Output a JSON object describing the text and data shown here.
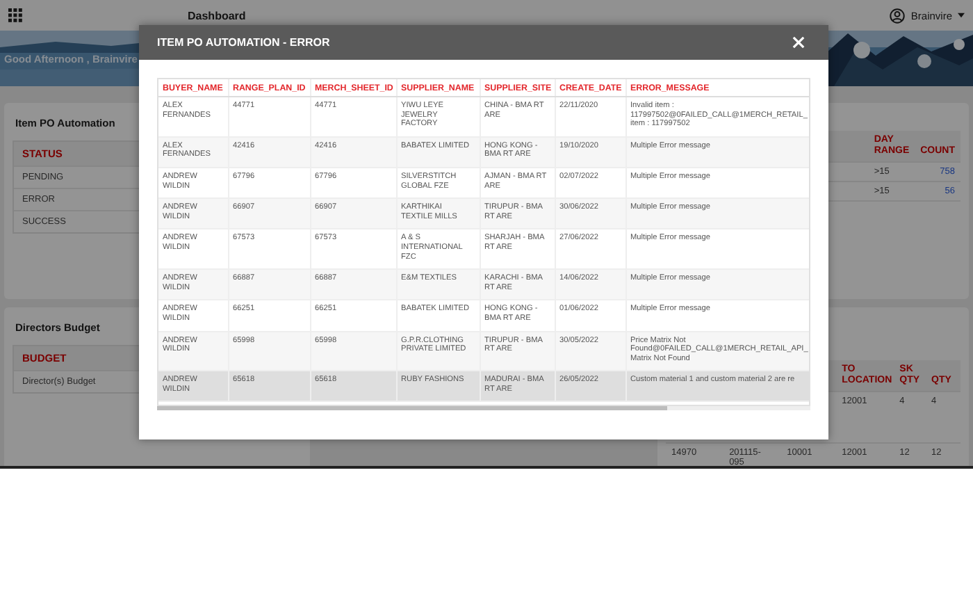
{
  "header": {
    "title": "Dashboard",
    "user": "Brainvire"
  },
  "banner": {
    "greeting": "Good Afternoon , Brainvire"
  },
  "status_panel": {
    "title": "Item PO Automation",
    "column": "STATUS",
    "rows": [
      "PENDING",
      "ERROR",
      "SUCCESS"
    ]
  },
  "budget_panel": {
    "title": "Directors Budget",
    "column": "BUDGET",
    "rows": [
      "Director(s) Budget"
    ]
  },
  "range_panel": {
    "columns": [
      "DAY RANGE",
      "COUNT"
    ],
    "rows": [
      {
        "cells": [
          ">15",
          "758"
        ]
      },
      {
        "cells": [
          ">15",
          "56"
        ]
      }
    ]
  },
  "transfer_panel": {
    "columns": [
      "TO LOCATION",
      "SK QTY",
      "QTY"
    ],
    "rows": [
      {
        "cells": [
          "12001",
          "4",
          "4"
        ]
      },
      {
        "cells": [
          "14970",
          "201115-095",
          "10001",
          "12001",
          "12",
          "12"
        ]
      }
    ]
  },
  "modal": {
    "title": "ITEM PO AUTOMATION - ERROR",
    "columns": [
      "BUYER_NAME",
      "RANGE_PLAN_ID",
      "MERCH_SHEET_ID",
      "SUPPLIER_NAME",
      "SUPPLIER_SITE",
      "CREATE_DATE",
      "ERROR_MESSAGE"
    ],
    "rows": [
      {
        "cells": [
          "ALEX FERNANDES",
          "44771",
          "44771",
          "YIWU LEYE JEWELRY FACTORY",
          "CHINA - BMA RT ARE",
          "22/11/2020",
          "Invalid item : 117997502@0FAILED_CALL@1MERCH_RETAIL_ item : 117997502"
        ],
        "selected": false
      },
      {
        "cells": [
          "ALEX FERNANDES",
          "42416",
          "42416",
          "BABATEX LIMITED",
          "HONG KONG - BMA RT ARE",
          "19/10/2020",
          "Multiple Error message"
        ],
        "selected": false
      },
      {
        "cells": [
          "ANDREW WILDIN",
          "67796",
          "67796",
          "SILVERSTITCH GLOBAL FZE",
          "AJMAN - BMA RT ARE",
          "02/07/2022",
          "Multiple Error message"
        ],
        "selected": false
      },
      {
        "cells": [
          "ANDREW WILDIN",
          "66907",
          "66907",
          "KARTHIKAI TEXTILE MILLS",
          "TIRUPUR - BMA RT ARE",
          "30/06/2022",
          "Multiple Error message"
        ],
        "selected": false
      },
      {
        "cells": [
          "ANDREW WILDIN",
          "67573",
          "67573",
          "A & S INTERNATIONAL FZC",
          "SHARJAH - BMA RT ARE",
          "27/06/2022",
          "Multiple Error message"
        ],
        "selected": false
      },
      {
        "cells": [
          "ANDREW WILDIN",
          "66887",
          "66887",
          "E&M TEXTILES",
          "KARACHI - BMA RT ARE",
          "14/06/2022",
          "Multiple Error message"
        ],
        "selected": false
      },
      {
        "cells": [
          "ANDREW WILDIN",
          "66251",
          "66251",
          "BABATEK LIMITED",
          "HONG KONG - BMA RT ARE",
          "01/06/2022",
          "Multiple Error message"
        ],
        "selected": false
      },
      {
        "cells": [
          "ANDREW WILDIN",
          "65998",
          "65998",
          "G.P.R.CLOTHING PRIVATE LIMITED",
          "TIRUPUR - BMA RT ARE",
          "30/05/2022",
          "Price Matrix Not Found@0FAILED_CALL@1MERCH_RETAIL_API_ Matrix Not Found"
        ],
        "selected": false
      },
      {
        "cells": [
          "ANDREW WILDIN",
          "65618",
          "65618",
          "RUBY FASHIONS",
          "MADURAI - BMA RT ARE",
          "26/05/2022",
          "Custom material 1 and custom material 2 are re"
        ],
        "selected": true
      }
    ]
  }
}
